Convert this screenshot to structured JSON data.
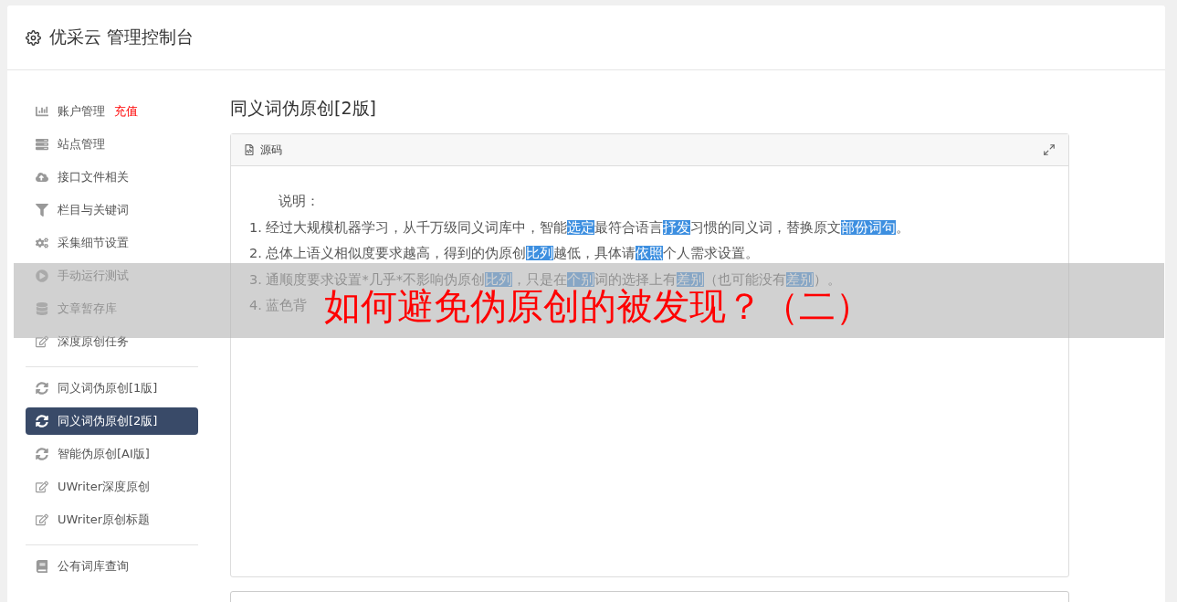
{
  "header": {
    "title": "优采云 管理控制台"
  },
  "sidebar": {
    "groups": [
      {
        "items": [
          {
            "kind": "chart",
            "label": "账户管理",
            "badge": "充值",
            "selected": false
          },
          {
            "kind": "server",
            "label": "站点管理",
            "selected": false
          },
          {
            "kind": "cloud",
            "label": "接口文件相关",
            "selected": false
          },
          {
            "kind": "filter",
            "label": "栏目与关键词",
            "selected": false
          },
          {
            "kind": "gears",
            "label": "采集细节设置",
            "selected": false
          },
          {
            "kind": "play",
            "label": "手动运行测试",
            "selected": false
          },
          {
            "kind": "database",
            "label": "文章暂存库",
            "selected": false
          },
          {
            "kind": "edit",
            "label": "深度原创任务",
            "selected": false
          }
        ]
      },
      {
        "items": [
          {
            "kind": "refresh",
            "label": "同义词伪原创[1版]",
            "selected": false
          },
          {
            "kind": "refresh",
            "label": "同义词伪原创[2版]",
            "selected": true
          },
          {
            "kind": "refresh",
            "label": "智能伪原创[AI版]",
            "selected": false
          },
          {
            "kind": "edit",
            "label": "UWriter深度原创",
            "selected": false
          },
          {
            "kind": "edit",
            "label": "UWriter原创标题",
            "selected": false
          }
        ]
      },
      {
        "items": [
          {
            "kind": "book",
            "label": "公有词库查询",
            "selected": false
          }
        ]
      }
    ]
  },
  "page_title": "同义词伪原创[2版]",
  "editor": {
    "toolbar_label": "源码",
    "heading": "说明：",
    "lines": [
      [
        {
          "text": "1. 经过大规模机器学习，从千万级同义词库中，智能",
          "highlighted": false
        },
        {
          "text": "选定",
          "highlighted": true
        },
        {
          "text": "最符合语言",
          "highlighted": false
        },
        {
          "text": "抒发",
          "highlighted": true
        },
        {
          "text": "习惯的同义词，替换原文",
          "highlighted": false
        },
        {
          "text": "部份",
          "highlighted": true
        },
        {
          "text": "词句",
          "highlighted": true
        },
        {
          "text": "。",
          "highlighted": false
        }
      ],
      [
        {
          "text": "2. 总体上语义相似度要求越高，得到的伪原创",
          "highlighted": false
        },
        {
          "text": "比列",
          "highlighted": true
        },
        {
          "text": "越低，具体请",
          "highlighted": false
        },
        {
          "text": "依照",
          "highlighted": true
        },
        {
          "text": "个人需求设置。",
          "highlighted": false
        }
      ],
      [
        {
          "text": "3. 通顺度要求设置*几乎*不影响伪原创",
          "highlighted": false
        },
        {
          "text": "比列",
          "highlighted": true
        },
        {
          "text": "，只是在",
          "highlighted": false
        },
        {
          "text": "个别",
          "highlighted": true
        },
        {
          "text": "词的选择上有",
          "highlighted": false
        },
        {
          "text": "差别",
          "highlighted": true
        },
        {
          "text": "（也可能没有",
          "highlighted": false
        },
        {
          "text": "差别",
          "highlighted": true
        },
        {
          "text": "）。",
          "highlighted": false
        }
      ],
      [
        {
          "text": "4. 蓝色背",
          "highlighted": false
        }
      ]
    ]
  },
  "banner": {
    "title": "如何避免伪原创的被发现？（二）"
  }
}
